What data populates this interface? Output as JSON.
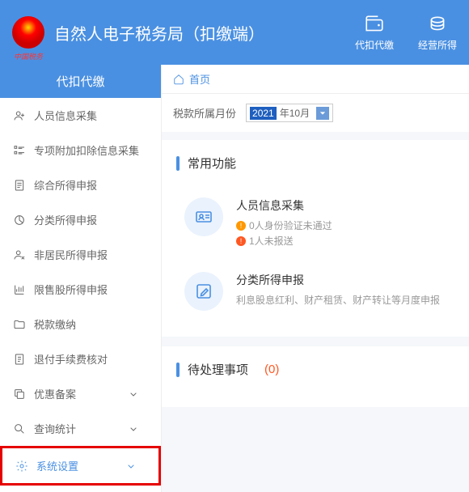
{
  "header": {
    "app_title": "自然人电子税务局（扣缴端）",
    "logo_caption": "中国税务",
    "actions": [
      {
        "label": "代扣代缴"
      },
      {
        "label": "经营所得"
      }
    ]
  },
  "sidebar": {
    "header": "代扣代缴",
    "items": [
      {
        "label": "人员信息采集",
        "expandable": false
      },
      {
        "label": "专项附加扣除信息采集",
        "expandable": false
      },
      {
        "label": "综合所得申报",
        "expandable": false
      },
      {
        "label": "分类所得申报",
        "expandable": false
      },
      {
        "label": "非居民所得申报",
        "expandable": false
      },
      {
        "label": "限售股所得申报",
        "expandable": false
      },
      {
        "label": "税款缴纳",
        "expandable": false
      },
      {
        "label": "退付手续费核对",
        "expandable": false
      },
      {
        "label": "优惠备案",
        "expandable": true
      },
      {
        "label": "查询统计",
        "expandable": true
      },
      {
        "label": "系统设置",
        "expandable": true,
        "highlighted": true
      }
    ]
  },
  "breadcrumb": {
    "home": "首页"
  },
  "period": {
    "label": "税款所属月份",
    "year": "2021",
    "month_suffix": "年10月"
  },
  "panels": {
    "common": {
      "title": "常用功能",
      "items": [
        {
          "title": "人员信息采集",
          "warnings": [
            {
              "type": "warn",
              "text": "0人身份验证未通过"
            },
            {
              "type": "err",
              "text": "1人未报送"
            }
          ]
        },
        {
          "title": "分类所得申报",
          "desc": "利息股息红利、财产租赁、财产转让等月度申报"
        }
      ]
    },
    "pending": {
      "title": "待处理事项",
      "count": "(0)"
    }
  }
}
